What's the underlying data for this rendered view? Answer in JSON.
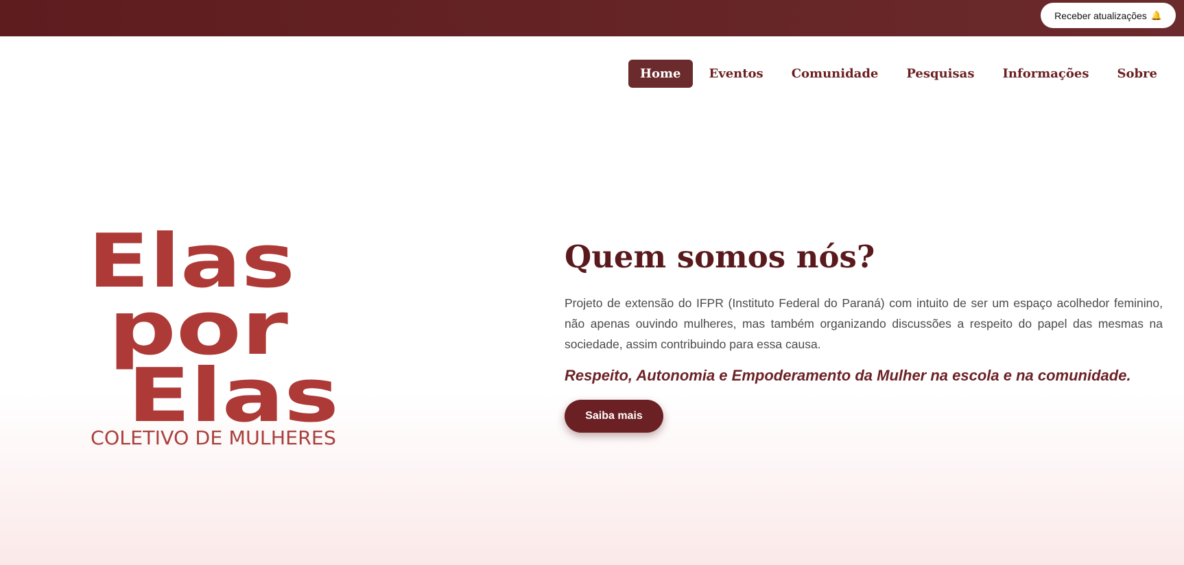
{
  "topbar": {
    "notify_label": "Receber atualizações",
    "notify_icon": "bell-icon"
  },
  "nav": {
    "items": [
      {
        "label": "Home",
        "active": true
      },
      {
        "label": "Eventos"
      },
      {
        "label": "Comunidade"
      },
      {
        "label": "Pesquisas"
      },
      {
        "label": "Informações"
      },
      {
        "label": "Sobre"
      }
    ]
  },
  "logo": {
    "line1": "Elas",
    "line2": "por",
    "line3": "Elas",
    "subtitle": "COLETIVO DE MULHERES"
  },
  "hero": {
    "title": "Quem somos nós?",
    "description": "Projeto de extensão do IFPR (Instituto Federal do Paraná) com intuito de ser um espaço acolhedor feminino, não apenas ouvindo mulheres, mas também organizando discussões a respeito do papel das mesmas na sociedade, assim contribuindo para essa causa.",
    "tagline": "Respeito, Autonomia e Empoderamento da Mulher na escola e na comunidade.",
    "cta_label": "Saiba mais"
  },
  "colors": {
    "brand": "#6b2a2b",
    "logo": "#ad3a36",
    "title": "#5a1a1d"
  }
}
